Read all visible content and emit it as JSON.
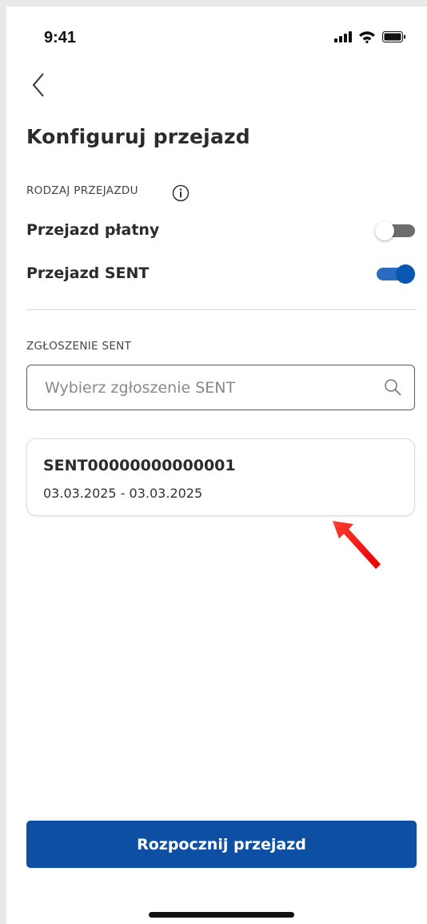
{
  "status_bar": {
    "time": "9:41"
  },
  "page_title": "Konfiguruj przejazd",
  "ride_type": {
    "label": "RODZAJ PRZEJAZDU",
    "paid": {
      "label": "Przejazd płatny",
      "enabled": false
    },
    "sent": {
      "label": "Przejazd SENT",
      "enabled": true
    }
  },
  "sent_report": {
    "label": "ZGŁOSZENIE SENT",
    "search_placeholder": "Wybierz zgłoszenie SENT",
    "selected": {
      "id": "SENT00000000000001",
      "date_range": "03.03.2025 - 03.03.2025"
    }
  },
  "start_button": {
    "label": "Rozpocznij przejazd"
  },
  "colors": {
    "primary": "#0d4fa3",
    "toggle_on": "#0a56b3",
    "toggle_off": "#6d6d6d",
    "annotation_arrow": "#ff1a1a"
  }
}
